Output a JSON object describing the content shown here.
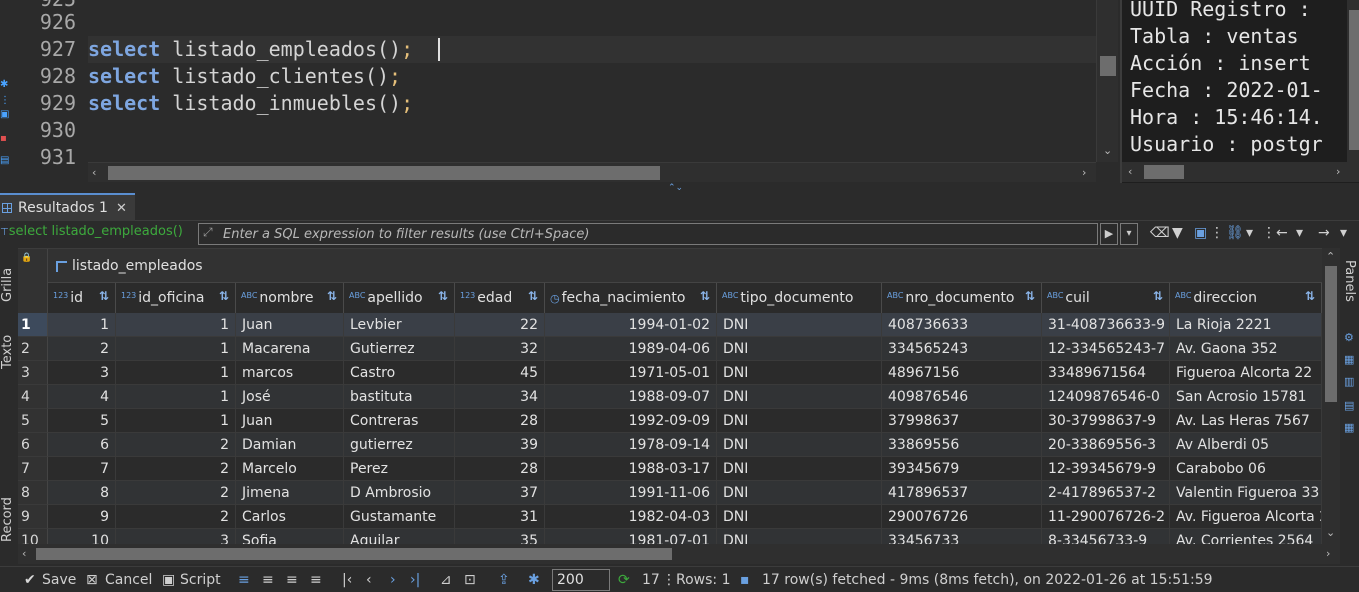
{
  "editor": {
    "lines": [
      {
        "num": "925",
        "code": ""
      },
      {
        "num": "926",
        "code": ""
      },
      {
        "num": "927",
        "kw": "select",
        "fn": "listado_empleados",
        "args": "()",
        "semi": ";"
      },
      {
        "num": "928",
        "kw": "select",
        "fn": "listado_clientes",
        "args": "()",
        "semi": ";"
      },
      {
        "num": "929",
        "kw": "select",
        "fn": "listado_inmuebles",
        "args": "()",
        "semi": ";"
      },
      {
        "num": "930",
        "code": ""
      },
      {
        "num": "931",
        "code": ""
      }
    ]
  },
  "output": {
    "lines": [
      "UUID Registro : ",
      "Tabla : ventas",
      "Acción : insert",
      "Fecha : 2022-01-",
      "Hora : 15:46:14.",
      "Usuario : postgr"
    ]
  },
  "results_tab": {
    "label": "Resultados 1",
    "close": "✕"
  },
  "filter": {
    "query": "select listado_empleados()",
    "placeholder": "Enter a SQL expression to filter results (use Ctrl+Space)"
  },
  "side_tabs": {
    "grid": "Grilla",
    "text": "Texto",
    "record": "Record"
  },
  "right_panel": {
    "label": "Panels"
  },
  "grid": {
    "title": "listado_empleados",
    "columns": [
      {
        "type": "123",
        "name": "id"
      },
      {
        "type": "123",
        "name": "id_oficina"
      },
      {
        "type": "ABC",
        "name": "nombre"
      },
      {
        "type": "ABC",
        "name": "apellido"
      },
      {
        "type": "123",
        "name": "edad"
      },
      {
        "type": "◷",
        "name": "fecha_nacimiento"
      },
      {
        "type": "ABC",
        "name": "tipo_documento"
      },
      {
        "type": "ABC",
        "name": "nro_documento"
      },
      {
        "type": "ABC",
        "name": "cuil"
      },
      {
        "type": "ABC",
        "name": "direccion"
      }
    ],
    "rows": [
      [
        "1",
        "1",
        "1",
        "Juan",
        "Levbier",
        "22",
        "1994-01-02",
        "DNI",
        "408736633",
        "31-408736633-9",
        "La Rioja 2221"
      ],
      [
        "2",
        "2",
        "1",
        "Macarena",
        "Gutierrez",
        "32",
        "1989-04-06",
        "DNI",
        "334565243",
        "12-334565243-7",
        "Av. Gaona 352"
      ],
      [
        "3",
        "3",
        "1",
        "marcos",
        "Castro",
        "45",
        "1971-05-01",
        "DNI",
        "48967156",
        "33489671564",
        "Figueroa Alcorta 22"
      ],
      [
        "4",
        "4",
        "1",
        "José",
        "bastituta",
        "34",
        "1988-09-07",
        "DNI",
        "409876546",
        "12409876546-0",
        "San Acrosio 15781"
      ],
      [
        "5",
        "5",
        "1",
        "Juan",
        "Contreras",
        "28",
        "1992-09-09",
        "DNI",
        "37998637",
        "30-37998637-9",
        "Av. Las Heras 7567"
      ],
      [
        "6",
        "6",
        "2",
        "Damian",
        "gutierrez",
        "39",
        "1978-09-14",
        "DNI",
        "33869556",
        "20-33869556-3",
        "Av Alberdi 05"
      ],
      [
        "7",
        "7",
        "2",
        "Marcelo",
        "Perez",
        "28",
        "1988-03-17",
        "DNI",
        "39345679",
        "12-39345679-9",
        "Carabobo 06"
      ],
      [
        "8",
        "8",
        "2",
        "Jimena",
        "D Ambrosio",
        "37",
        "1991-11-06",
        "DNI",
        "417896537",
        "2-417896537-2",
        "Valentin Figueroa 33"
      ],
      [
        "9",
        "9",
        "2",
        "Carlos",
        "Gustamante",
        "31",
        "1982-04-03",
        "DNI",
        "290076726",
        "11-290076726-2",
        "Av. Figueroa Alcorta 2"
      ],
      [
        "10",
        "10",
        "3",
        "Sofia",
        "Aguilar",
        "35",
        "1981-07-01",
        "DNI",
        "33456733",
        "8-33456733-9",
        "Av. Corrientes 2564"
      ]
    ]
  },
  "status": {
    "save": "Save",
    "cancel": "Cancel",
    "script": "Script",
    "fetch_size": "200",
    "refresh_count": "17",
    "rows": "Rows: 1",
    "message": "17 row(s) fetched - 9ms (8ms fetch), on 2022-01-26 at 15:51:59"
  },
  "colors": {
    "keyword": "#7ea6e0",
    "accent": "#6aa0e0",
    "ok": "#3daa3d"
  }
}
